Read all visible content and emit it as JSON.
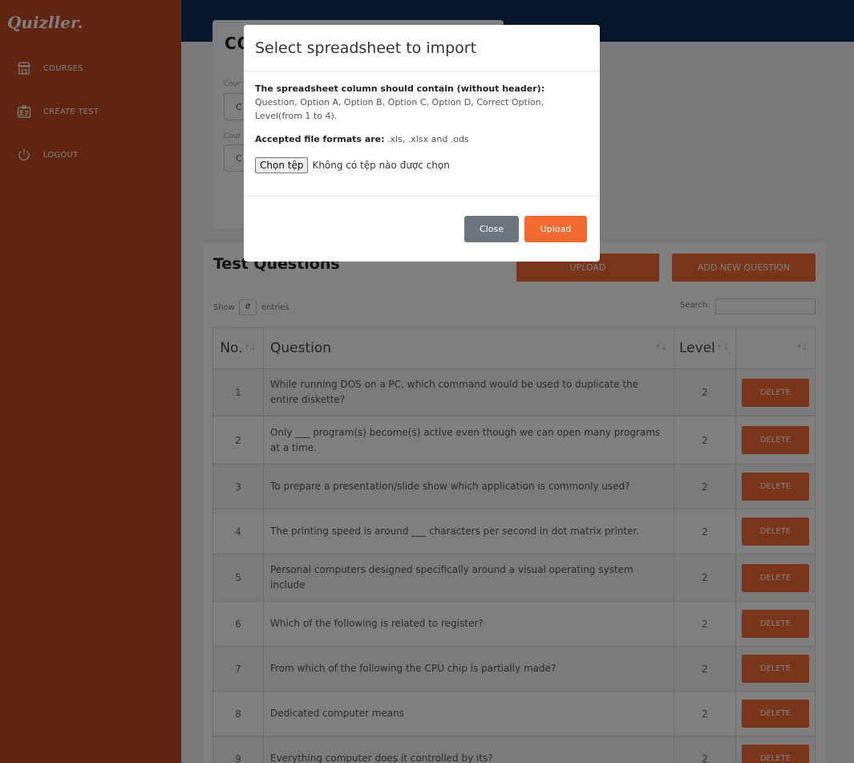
{
  "app": {
    "brand": "Quizller."
  },
  "sidebar": {
    "items": [
      {
        "label": "COURSES",
        "icon": "store-icon"
      },
      {
        "label": "CREATE TEST",
        "icon": "id-card-icon"
      },
      {
        "label": "LOGOUT",
        "icon": "power-icon"
      }
    ]
  },
  "course_card": {
    "title": "CO",
    "field1_label": "Cour",
    "field1_value": "C",
    "field2_label": "Cour",
    "field2_value": "C"
  },
  "questions": {
    "title": "Test Questions",
    "upload_label": "UPLOAD",
    "add_label": "ADD NEW QUESTION",
    "show_label": "Show",
    "entries_label": "entries",
    "search_label": "Search:",
    "search_value": "",
    "columns": {
      "no": "No.",
      "question": "Question",
      "level": "Level"
    },
    "delete_label": "DELETE",
    "rows": [
      {
        "no": "1",
        "question": "While running DOS on a PC, which command would be used to duplicate the entire diskette?",
        "level": "2"
      },
      {
        "no": "2",
        "question": "Only ___ program(s) become(s) active even though we can open many programs at a time.",
        "level": "2"
      },
      {
        "no": "3",
        "question": "To prepare a presentation/slide show which application is commonly used?",
        "level": "2"
      },
      {
        "no": "4",
        "question": "The printing speed is around ___ characters per second in dot matrix printer.",
        "level": "2"
      },
      {
        "no": "5",
        "question": "Personal computers designed specifically around a visual operating system include",
        "level": "2"
      },
      {
        "no": "6",
        "question": "Which of the following is related to register?",
        "level": "2"
      },
      {
        "no": "7",
        "question": "From which of the following the CPU chip is partially made?",
        "level": "2"
      },
      {
        "no": "8",
        "question": "Dedicated computer means",
        "level": "2"
      },
      {
        "no": "9",
        "question": "Everything computer does it controlled by its?",
        "level": "2"
      }
    ]
  },
  "modal": {
    "title": "Select spreadsheet to import",
    "columns_heading": "The spreadsheet column should contain (without header):",
    "columns_text": "Question, Option A, Option B, Option C, Option D, Correct Option, Level(from 1 to 4).",
    "formats_label": "Accepted file formats are:",
    "formats_value": " .xls, .xlsx and .ods",
    "file_button": "Chọn tệp",
    "file_status": "Không có tệp nào được chọn",
    "close_label": "Close",
    "upload_label": "Upload"
  },
  "colors": {
    "sidebar": "#bf4a22",
    "topbar": "#0e2a55",
    "accent": "#f26a32",
    "close": "#6c757d"
  }
}
